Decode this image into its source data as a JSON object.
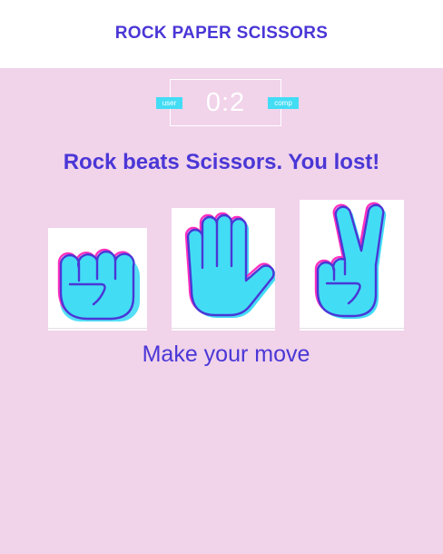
{
  "header": {
    "title": "ROCK PAPER SCISSORS"
  },
  "scoreboard": {
    "score": "0:2",
    "user_label": "user",
    "comp_label": "comp"
  },
  "result_message": "Rock beats Scissors. You lost!",
  "choices": [
    {
      "name": "rock",
      "icon": "fist-icon"
    },
    {
      "name": "paper",
      "icon": "open-hand-icon"
    },
    {
      "name": "scissors",
      "icon": "peace-hand-icon"
    }
  ],
  "prompt": "Make your move",
  "colors": {
    "background": "#f1d3ea",
    "accent_text": "#4a37d6",
    "hand_fill": "#43dcf5",
    "hand_outline_pink": "#ff2fbf",
    "badge": "#43dcf5"
  }
}
